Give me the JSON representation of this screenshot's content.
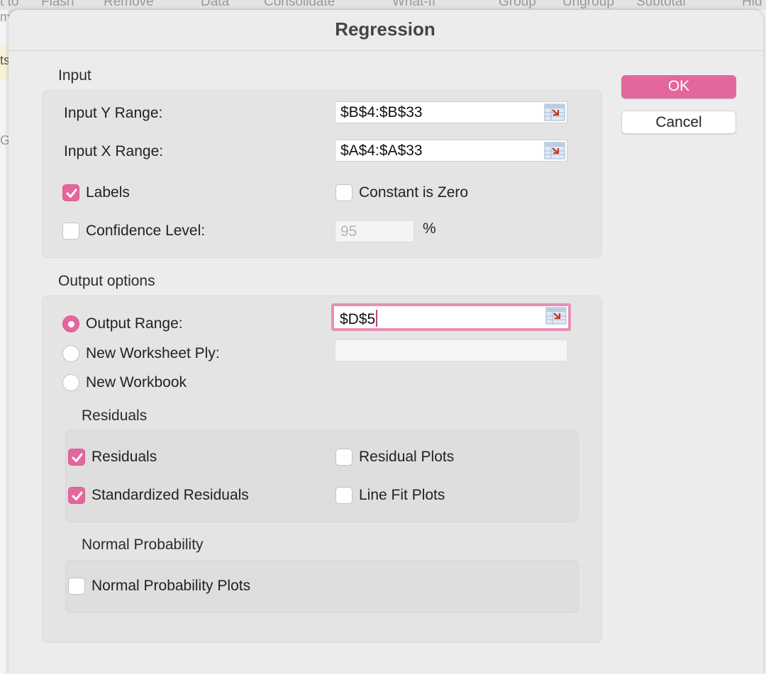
{
  "background": {
    "ribbon_items": [
      "t to",
      "Flash",
      "Remove",
      "Data",
      "Consolidate",
      "What-If",
      "Group",
      "Ungroup",
      "Subtotal",
      "Hid"
    ],
    "left_fragment": "ts",
    "left_fragment2": "m",
    "col_fragment": "G"
  },
  "dialog": {
    "title": "Regression",
    "ok_label": "OK",
    "cancel_label": "Cancel",
    "input": {
      "section_label": "Input",
      "y_range_label": "Input Y Range:",
      "y_range_value": "$B$4:$B$33",
      "x_range_label": "Input X Range:",
      "x_range_value": "$A$4:$A$33",
      "labels_label": "Labels",
      "labels_checked": true,
      "constant_zero_label": "Constant is Zero",
      "constant_zero_checked": false,
      "confidence_label": "Confidence Level:",
      "confidence_checked": false,
      "confidence_value": "95",
      "percent_sign": "%"
    },
    "output": {
      "section_label": "Output options",
      "output_range_label": "Output Range:",
      "output_range_value": "$D$5",
      "new_ws_label": "New Worksheet Ply:",
      "new_wb_label": "New Workbook",
      "selected": "output_range",
      "residuals_section": "Residuals",
      "residuals_label": "Residuals",
      "residuals_checked": true,
      "std_residuals_label": "Standardized Residuals",
      "std_residuals_checked": true,
      "residual_plots_label": "Residual Plots",
      "residual_plots_checked": false,
      "line_fit_label": "Line Fit Plots",
      "line_fit_checked": false,
      "normal_section": "Normal Probability",
      "normal_plots_label": "Normal Probability Plots",
      "normal_plots_checked": false
    }
  },
  "colors": {
    "accent": "#e3679c",
    "focus_ring": "#e690b3"
  }
}
